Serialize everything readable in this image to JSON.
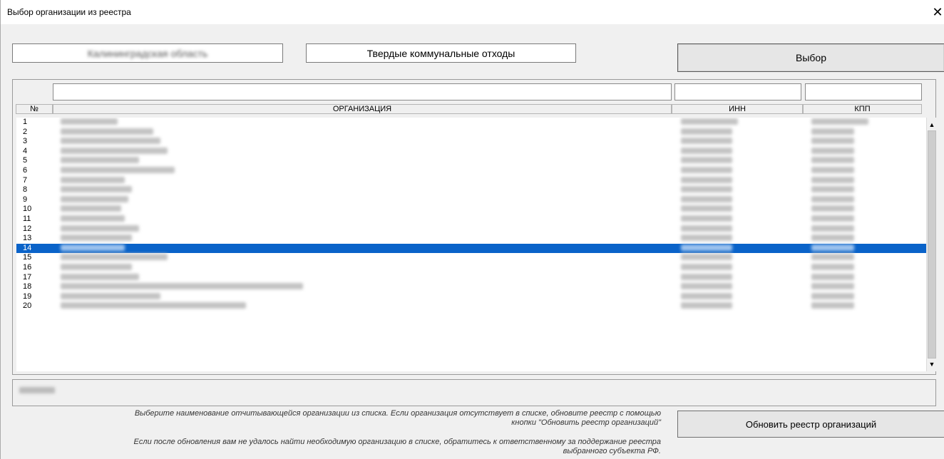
{
  "window": {
    "title": "Выбор организации из реестра",
    "close_glyph": "✕"
  },
  "header": {
    "region_value": "Калининградская область",
    "waste_type_value": "Твердые коммунальные отходы",
    "select_label": "Выбор"
  },
  "grid": {
    "columns": {
      "num": "№",
      "org": "ОРГАНИЗАЦИЯ",
      "inn": "ИНН",
      "kpp": "КПП"
    },
    "rows": [
      {
        "num": "1"
      },
      {
        "num": "2"
      },
      {
        "num": "3"
      },
      {
        "num": "4"
      },
      {
        "num": "5"
      },
      {
        "num": "6"
      },
      {
        "num": "7"
      },
      {
        "num": "8"
      },
      {
        "num": "9"
      },
      {
        "num": "10"
      },
      {
        "num": "11"
      },
      {
        "num": "12"
      },
      {
        "num": "13"
      },
      {
        "num": "14",
        "selected": true
      },
      {
        "num": "15"
      },
      {
        "num": "16"
      },
      {
        "num": "17"
      },
      {
        "num": "18"
      },
      {
        "num": "19"
      },
      {
        "num": "20"
      }
    ],
    "selected_index": 13
  },
  "footer": {
    "hint_1_line_1": "Выберите наименование отчитывающейся организации из списка. Если организация отсутствует в списке, обновите реестр с помощью",
    "hint_1_line_2": "кнопки \"Обновить реестр организаций\"",
    "hint_2_line_1": "Если после обновления вам не удалось найти необходимую организацию в списке, обратитесь к ответственному за поддержание реестра",
    "hint_2_line_2": "выбранного субъекта РФ.",
    "refresh_label": "Обновить реестр организаций"
  },
  "colors": {
    "selection": "#0a63c9",
    "background": "#f0f0f0"
  }
}
